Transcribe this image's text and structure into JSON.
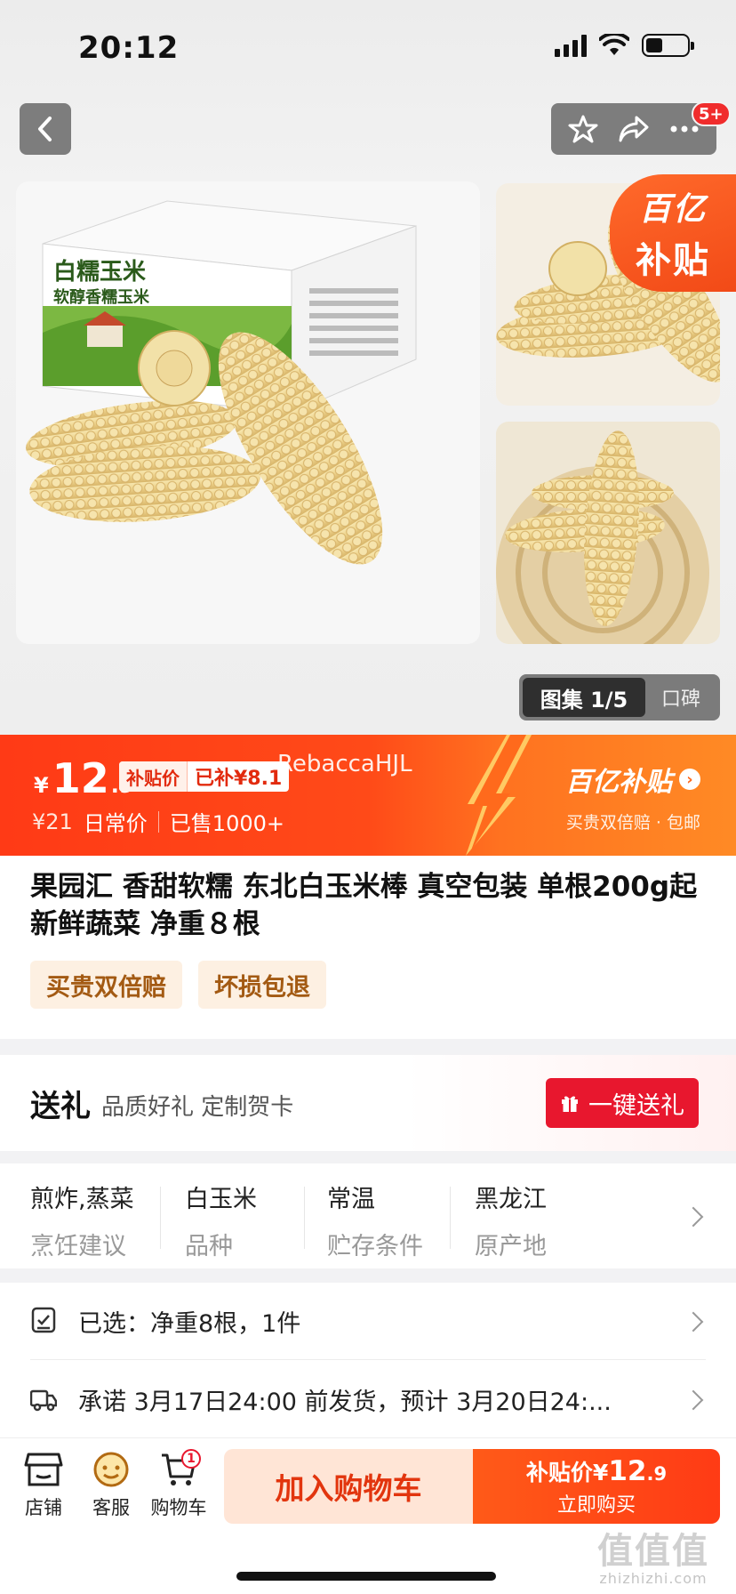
{
  "status": {
    "time": "20:12"
  },
  "nav": {
    "badge": "5+"
  },
  "hero": {
    "box_brand": "白糯玉米",
    "box_sub": "软醇香糯玉米",
    "subsidy_tag_line1": "百亿",
    "subsidy_tag_line2": "补贴",
    "gallery_active": "图集 1/5",
    "gallery_inactive": "口碑"
  },
  "price": {
    "currency": "¥",
    "integer": "12",
    "decimal": ".9",
    "tag_label": "补贴价",
    "tag_saving": "已补¥8.1",
    "watermark": "RebaccaHJL",
    "original": "¥21",
    "original_label": "日常价",
    "sold": "已售1000+",
    "brand": "百亿补贴",
    "brand_arrow": "›",
    "brand_sub": "买贵双倍赔 · 包邮"
  },
  "product": {
    "title": "果园汇 香甜软糯 东北白玉米棒 真空包装 单根200g起 新鲜蔬菜 净重８根",
    "badges": [
      "买贵双倍赔",
      "坏损包退"
    ]
  },
  "gift": {
    "title": "送礼",
    "desc": "品质好礼 定制贺卡",
    "button": "一键送礼"
  },
  "specs": [
    {
      "value": "煎炸,蒸菜",
      "key": "烹饪建议"
    },
    {
      "value": "白玉米",
      "key": "品种"
    },
    {
      "value": "常温",
      "key": "贮存条件"
    },
    {
      "value": "黑龙江",
      "key": "原产地"
    }
  ],
  "options": {
    "selected": "已选：净重8根，1件",
    "shipping": "承诺 3月17日24:00 前发货，预计 3月20日24:..."
  },
  "bottom": {
    "shop": "店铺",
    "service": "客服",
    "cart": "购物车",
    "cart_count": "1",
    "add_cart": "加入购物车",
    "buy_price_label": "补贴价¥",
    "buy_price_int": "12",
    "buy_price_dec": ".9",
    "buy_now": "立即购买"
  },
  "watermark_corner": {
    "line1": "值值值",
    "line2": "zhizhizhi.com"
  },
  "colors": {
    "accent": "#ff3a16",
    "gift_red": "#e8172e",
    "badge_text": "#a35a13"
  }
}
